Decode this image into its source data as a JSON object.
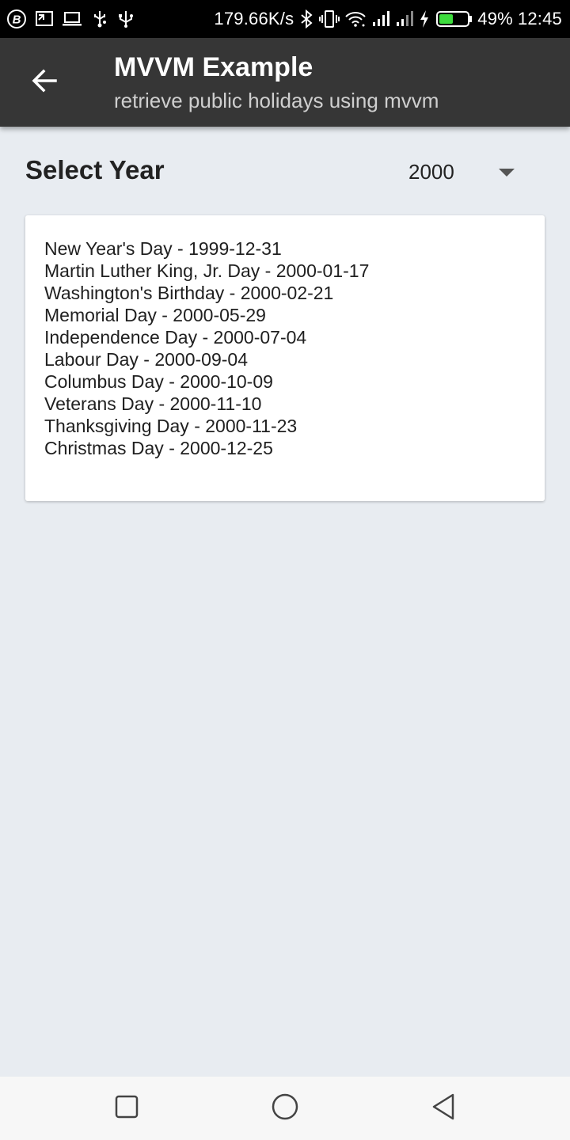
{
  "status_bar": {
    "network_speed": "179.66K/s",
    "battery_percent": "49%",
    "battery_level": 0.49,
    "time": "12:45",
    "left_icons": [
      "b-badge-icon",
      "cast-icon",
      "laptop-icon",
      "usb-debug-icon",
      "usb-icon"
    ],
    "right_icons": [
      "bluetooth-icon",
      "vibrate-icon",
      "wifi-icon",
      "signal-icon",
      "signal-icon",
      "charging-icon",
      "battery-icon"
    ]
  },
  "app_bar": {
    "title": "MVVM Example",
    "subtitle": "retrieve public holidays using mvvm",
    "background": "#363636"
  },
  "year_selector": {
    "label": "Select Year",
    "selected_year": "2000"
  },
  "holidays": [
    "New Year's Day - 1999-12-31",
    "Martin Luther King, Jr. Day - 2000-01-17",
    "Washington's Birthday - 2000-02-21",
    "Memorial Day - 2000-05-29",
    "Independence Day - 2000-07-04",
    "Labour Day - 2000-09-04",
    "Columbus Day - 2000-10-09",
    "Veterans Day - 2000-11-10",
    "Thanksgiving Day - 2000-11-23",
    "Christmas Day - 2000-12-25"
  ],
  "nav_bar": {
    "buttons": [
      "recents-square-icon",
      "home-circle-icon",
      "back-triangle-icon"
    ]
  },
  "colors": {
    "background": "#e8ecf1",
    "card": "#ffffff",
    "battery_fill": "#3ddc3d"
  }
}
